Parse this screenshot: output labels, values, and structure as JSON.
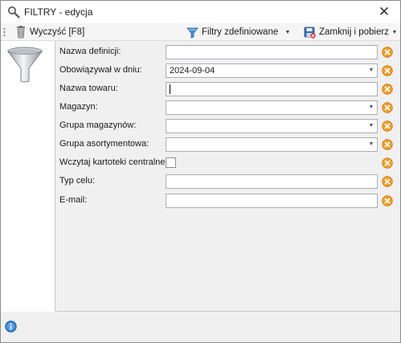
{
  "window": {
    "title": "FILTRY - edycja",
    "close_glyph": "✕"
  },
  "toolbar": {
    "clear_label": "Wyczyść [F8]",
    "filters_label": "Filtry zdefiniowane",
    "close_fetch_label": "Zamknij i pobierz",
    "dropdown_glyph": "▼"
  },
  "form": {
    "fields": [
      {
        "label": "Nazwa definicji:",
        "value": "",
        "type": "text"
      },
      {
        "label": "Obowiązywał w dniu:",
        "value": "2024-09-04",
        "type": "combo"
      },
      {
        "label": "Nazwa towaru:",
        "value": "",
        "type": "text"
      },
      {
        "label": "Magazyn:",
        "value": "",
        "type": "combo"
      },
      {
        "label": "Grupa magazynów:",
        "value": "",
        "type": "combo"
      },
      {
        "label": "Grupa asortymentowa:",
        "value": "",
        "type": "combo"
      },
      {
        "label": "Wczytaj kartoteki centralne:",
        "value": "",
        "type": "checkbox"
      },
      {
        "label": "Typ celu:",
        "value": "",
        "type": "text"
      },
      {
        "label": "E-mail:",
        "value": "",
        "type": "text"
      }
    ]
  },
  "colors": {
    "clear_icon": "#f0a030",
    "info_icon": "#2f7fd0"
  }
}
